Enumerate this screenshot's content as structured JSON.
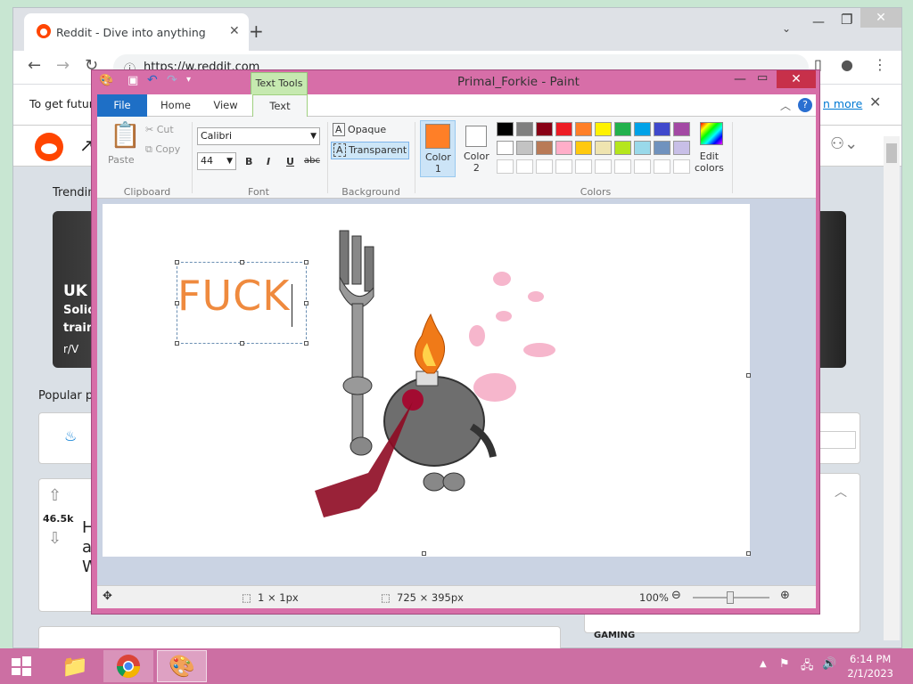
{
  "browser": {
    "tab_title": "Reddit - Dive into anything",
    "url": "https://w.reddit.com"
  },
  "reddit": {
    "cookie_text": "To get futur",
    "cookie_link": "n more",
    "trending_label": "Trendin",
    "trend_headline": "UK C",
    "trend_line1": "Solid",
    "trend_line2": "train",
    "trend_sub": "r/V",
    "popular_label": "Popular p",
    "post_votes": "46.5k",
    "post_title_fragments": [
      "H",
      "a",
      "W"
    ],
    "gaming_label": "GAMING"
  },
  "paint": {
    "window_title": "Primal_Forkie - Paint",
    "context_tab": "Text Tools",
    "tabs": [
      "File",
      "Home",
      "View",
      "Text"
    ],
    "clipboard": {
      "paste": "Paste",
      "cut": "Cut",
      "copy": "Copy",
      "group": "Clipboard"
    },
    "font": {
      "family": "Calibri",
      "size": "44",
      "bold": "B",
      "italic": "I",
      "underline": "U",
      "strike": "abc",
      "group": "Font"
    },
    "background": {
      "opaque": "Opaque",
      "transparent": "Transparent",
      "group": "Background"
    },
    "colors": {
      "color1_label": "Color\n1",
      "color1": "#ff7f27",
      "color2_label": "Color\n2",
      "color2": "#ffffff",
      "edit_label": "Edit\ncolors",
      "group": "Colors",
      "palette_row1": [
        "#000000",
        "#7f7f7f",
        "#880015",
        "#ed1c24",
        "#ff7f27",
        "#fff200",
        "#22b14c",
        "#00a2e8",
        "#3f48cc",
        "#a349a4"
      ],
      "palette_row2": [
        "#ffffff",
        "#c3c3c3",
        "#b97a57",
        "#ffaec9",
        "#ffc90e",
        "#efe4b0",
        "#b5e61d",
        "#99d9ea",
        "#7092be",
        "#c8bfe7"
      ]
    },
    "canvas_text": "FUCK",
    "status": {
      "selection": "1 × 1px",
      "size": "725 × 395px",
      "zoom": "100%"
    }
  },
  "taskbar": {
    "time": "6:14 PM",
    "date": "2/1/2023"
  }
}
